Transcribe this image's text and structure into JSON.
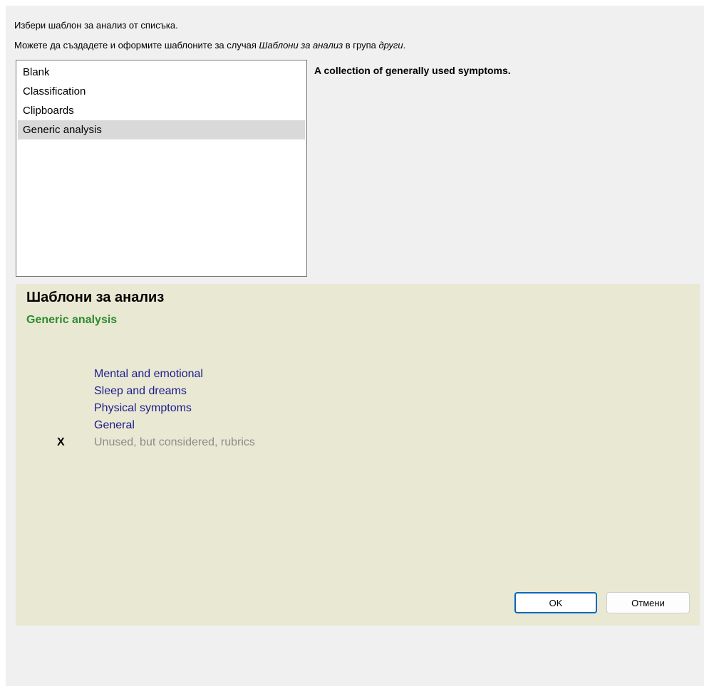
{
  "instructions": {
    "line1": "Избери шаблон за анализ от списъка.",
    "line2_prefix": "Можете да създадете и оформите шаблоните за случая ",
    "line2_italic1": "Шаблони за анализ",
    "line2_middle": " в група ",
    "line2_italic2": "други",
    "line2_suffix": "."
  },
  "template_list": {
    "items": [
      {
        "label": "Blank",
        "selected": false
      },
      {
        "label": "Classification",
        "selected": false
      },
      {
        "label": "Clipboards",
        "selected": false
      },
      {
        "label": "Generic analysis",
        "selected": true
      }
    ]
  },
  "template_description": "A collection of generally used symptoms.",
  "preview": {
    "title": "Шаблони за анализ",
    "subtitle": "Generic analysis",
    "sections": [
      {
        "mark": "",
        "label": "Mental and emotional",
        "unused": false
      },
      {
        "mark": "",
        "label": "Sleep and dreams",
        "unused": false
      },
      {
        "mark": "",
        "label": "Physical symptoms",
        "unused": false
      },
      {
        "mark": "",
        "label": "General",
        "unused": false
      },
      {
        "mark": "X",
        "label": "Unused, but considered, rubrics",
        "unused": true
      }
    ],
    "background_color": "#e9e8d3",
    "subtitle_color": "#2e8b2e",
    "section_color": "#1c1c8c"
  },
  "buttons": {
    "ok_label": "OK",
    "cancel_label": "Отмени"
  }
}
